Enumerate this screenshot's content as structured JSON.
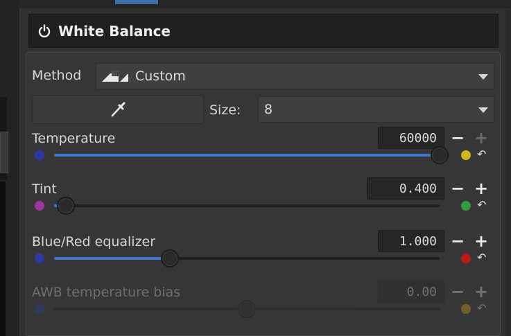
{
  "header": {
    "title": "White Balance"
  },
  "method": {
    "label": "Method",
    "value": "Custom"
  },
  "picker": {
    "size_label": "Size:",
    "size_value": "8"
  },
  "sliders": [
    {
      "label": "Temperature",
      "value": "60000",
      "fraction": 1.0,
      "left_color": "#2b39a8",
      "right_color": "#d4b514",
      "enabled": true
    },
    {
      "label": "Tint",
      "value": "0.400",
      "fraction": 0.03,
      "left_color": "#a0359e",
      "right_color": "#2fa03a",
      "enabled": true
    },
    {
      "label": "Blue/Red equalizer",
      "value": "1.000",
      "fraction": 0.3,
      "left_color": "#2b39a8",
      "right_color": "#c21818",
      "enabled": true
    },
    {
      "label": "AWB temperature bias",
      "value": "0.00",
      "fraction": 0.5,
      "left_color": "#2b39a8",
      "right_color": "#d4b514",
      "enabled": false
    }
  ],
  "icons": {
    "header": "power-icon",
    "method": "white-balance-method-icon",
    "picker": "color-picker-icon",
    "reset": "undo-icon"
  },
  "colors": {
    "accent": "#3b7bd1",
    "panel": "#363636",
    "header_bg": "#202020"
  }
}
